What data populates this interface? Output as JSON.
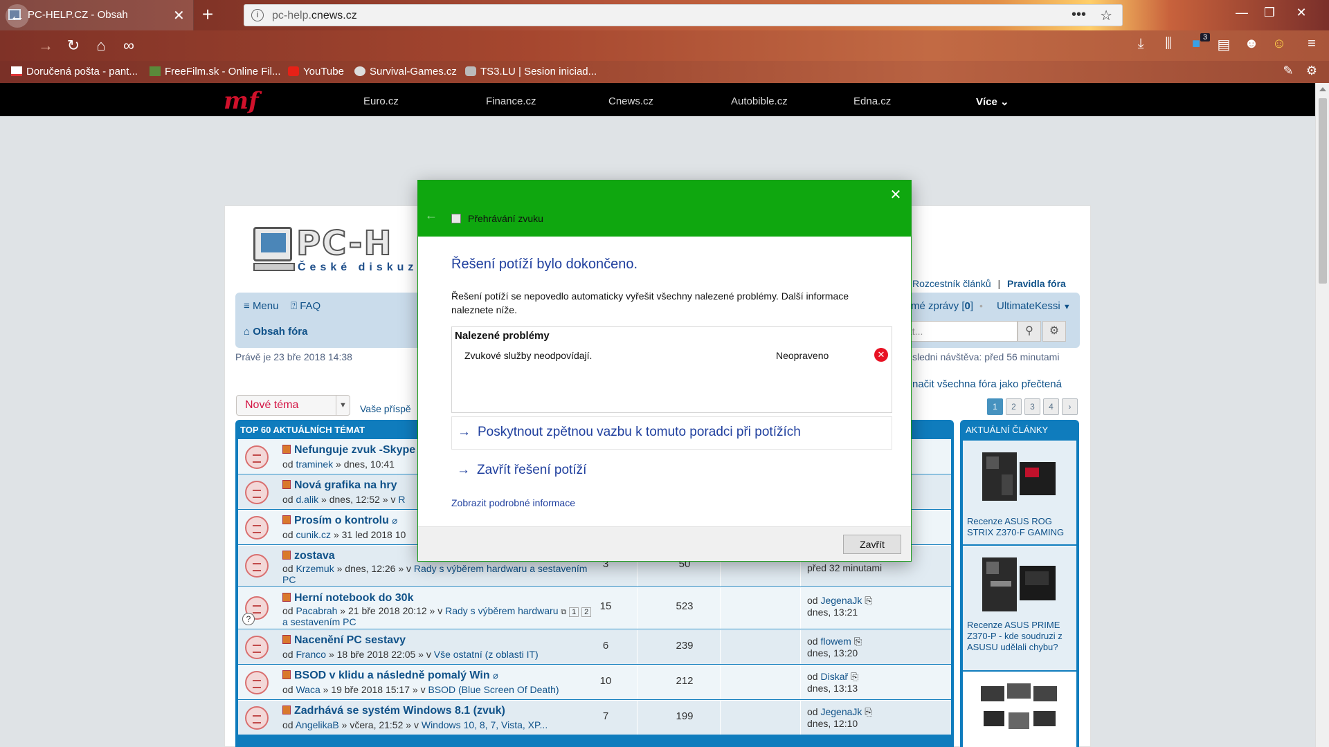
{
  "browser": {
    "tab_title": "PC-HELP.CZ - Obsah",
    "tab_close": "✕",
    "new_tab": "+",
    "url_prefix": "pc-help.",
    "url_domain": "cnews.cz",
    "page_actions": "•••",
    "notification_count": "3",
    "bookmarks": [
      {
        "label": "Doručená pošta - pant..."
      },
      {
        "label": "FreeFilm.sk - Online Fil..."
      },
      {
        "label": "YouTube"
      },
      {
        "label": "Survival-Games.cz"
      },
      {
        "label": "TS3.LU | Sesion iniciad..."
      }
    ]
  },
  "mfbar": {
    "logo": "mf",
    "links": [
      "Euro.cz",
      "Finance.cz",
      "Cnews.cz",
      "Autobible.cz",
      "Edna.cz"
    ],
    "more": "Více"
  },
  "forum": {
    "logo_big": "PC-H",
    "logo_sub": "České diskuz",
    "top_links": {
      "articles": "Rozcestník článků",
      "sep": "|",
      "rules": "Pravidla fóra"
    },
    "menu": "Menu",
    "faq": "FAQ",
    "board_index": "Obsah fóra",
    "messages": "mé zprávy [",
    "messages_count": "0",
    "messages_end": "]",
    "username": "UltimateKessi",
    "search_placeholder": "at...",
    "datetime": "Právě je 23 bře 2018 14:38",
    "last_visit": "sledni návštěva: před 56 minutami",
    "mark_all": "načit všechna fóra jako přečtená",
    "new_topic": "Nové téma",
    "your_posts": "Vaše příspě",
    "pages": [
      "1",
      "2",
      "3",
      "4"
    ],
    "table_title": "TOP 60 AKTUÁLNÍCH TÉMAT",
    "topics": [
      {
        "title": "Nefunguje zvuk -Skype",
        "author": "traminek",
        "when": "dnes, 10:41",
        "forum": ""
      },
      {
        "title": "Nová grafika na hry",
        "author": "d.alik",
        "when": "dnes, 12:52",
        "forum": "R"
      },
      {
        "title": "Prosím o kontrolu",
        "author": "cunik.cz",
        "when": "31 led 2018 10",
        "forum": ""
      },
      {
        "title": "zostava",
        "author": "Krzemuk",
        "when": "dnes, 12:26",
        "forum": "Rady s výběrem hardwaru a sestavením",
        "forum2": "PC",
        "replies": "3",
        "views": "50",
        "last_by": "",
        "last_time": "před 32 minutami"
      },
      {
        "title": "Herní notebook do 30k",
        "author": "Pacabrah",
        "when": "21 bře 2018 20:12",
        "forum": "Rady s výběrem hardwaru",
        "forum2": "a sestavením PC",
        "pages": [
          "1",
          "2"
        ],
        "replies": "15",
        "views": "523",
        "last_by": "JegenaJk",
        "last_time": "dnes, 13:21"
      },
      {
        "title": "Nacenění PC sestavy",
        "author": "Franco",
        "when": "18 bře 2018 22:05",
        "forum": "Vše ostatní (z oblasti IT)",
        "replies": "6",
        "views": "239",
        "last_by": "flowem",
        "last_time": "dnes, 13:20"
      },
      {
        "title": "BSOD v klidu a následně pomalý Win",
        "author": "Waca",
        "when": "19 bře 2018 15:17",
        "forum": "BSOD (Blue Screen Of Death)",
        "replies": "10",
        "views": "212",
        "last_by": "Diskař",
        "last_time": "dnes, 13:13"
      },
      {
        "title": "Zadrhává se systém Windows 8.1 (zvuk)",
        "author": "AngelikaB",
        "when": "včera, 21:52",
        "forum": "Windows 10, 8, 7, Vista, XP...",
        "replies": "7",
        "views": "199",
        "last_by": "JegenaJk",
        "last_time": "dnes, 12:10"
      }
    ],
    "labels": {
      "by": "od",
      "sep": "»",
      "in": "v"
    },
    "side_title": "AKTUÁLNÍ ČLÁNKY",
    "articles": [
      {
        "caption": "Recenze ASUS ROG STRIX Z370-F GAMING"
      },
      {
        "caption": "Recenze ASUS PRIME Z370-P - kde soudruzi z ASUSU udělali chybu?"
      }
    ]
  },
  "dialog": {
    "title": "Přehrávání zvuku",
    "heading": "Řešení potíží bylo dokončeno.",
    "description": "Řešení potíží se nepovedlo automaticky vyřešit všechny nalezené problémy. Další informace naleznete níže.",
    "problems_header": "Nalezené problémy",
    "problem_name": "Zvukové služby neodpovídají.",
    "problem_status": "Neopraveno",
    "feedback_link": "Poskytnout zpětnou vazbu k tomuto poradci při potížích",
    "close_link": "Zavřít řešení potíží",
    "details_link": "Zobrazit podrobné informace",
    "close_button": "Zavřít"
  },
  "colors": {
    "dialog_header": "#0fa70f",
    "forum_blue": "#0f7cbd",
    "error_red": "#e81123"
  }
}
